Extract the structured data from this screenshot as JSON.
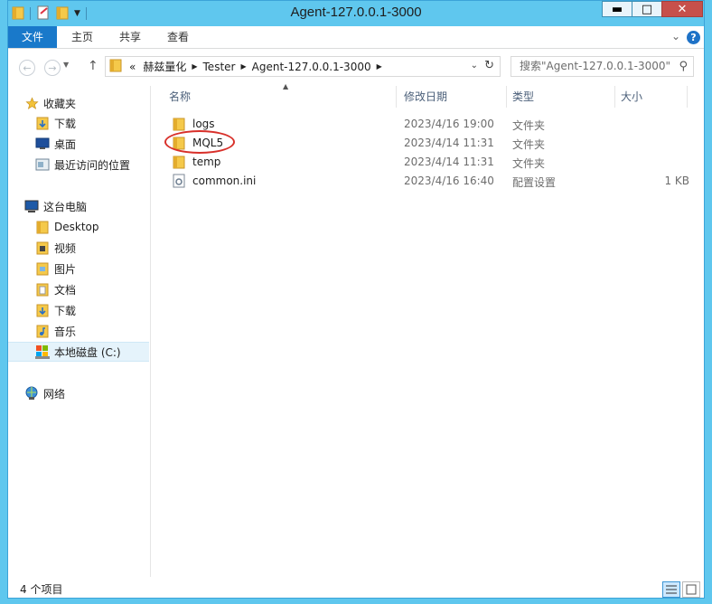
{
  "window": {
    "title": "Agent-127.0.0.1-3000"
  },
  "title_controls": {
    "minimize": "▬",
    "maximize": "□",
    "close": "✕"
  },
  "ribbon": {
    "tabs": [
      "文件",
      "主页",
      "共享",
      "查看"
    ],
    "help": "?"
  },
  "address": {
    "overflow": "«",
    "crumbs": [
      "赫兹量化",
      "Tester",
      "Agent-127.0.0.1-3000"
    ]
  },
  "search": {
    "placeholder": "搜索\"Agent-127.0.0.1-3000\""
  },
  "navpane": {
    "favorites_label": "收藏夹",
    "favorites": [
      "下载",
      "桌面",
      "最近访问的位置"
    ],
    "pc_label": "这台电脑",
    "pc_items": [
      "Desktop",
      "视频",
      "图片",
      "文档",
      "下载",
      "音乐",
      "本地磁盘 (C:)"
    ],
    "network_label": "网络"
  },
  "columns": {
    "name": "名称",
    "date": "修改日期",
    "type": "类型",
    "size": "大小"
  },
  "files": [
    {
      "name": "logs",
      "date": "2023/4/16 19:00",
      "type": "文件夹",
      "size": ""
    },
    {
      "name": "MQL5",
      "date": "2023/4/14 11:31",
      "type": "文件夹",
      "size": ""
    },
    {
      "name": "temp",
      "date": "2023/4/14 11:31",
      "type": "文件夹",
      "size": ""
    },
    {
      "name": "common.ini",
      "date": "2023/4/16 16:40",
      "type": "配置设置",
      "size": "1 KB"
    }
  ],
  "status": {
    "count": "4 个项目"
  },
  "colors": {
    "title_bar": "#5fc7ee",
    "file_tab": "#1979ca",
    "annotation": "#d8302a",
    "selection": "#e5f3fb"
  }
}
